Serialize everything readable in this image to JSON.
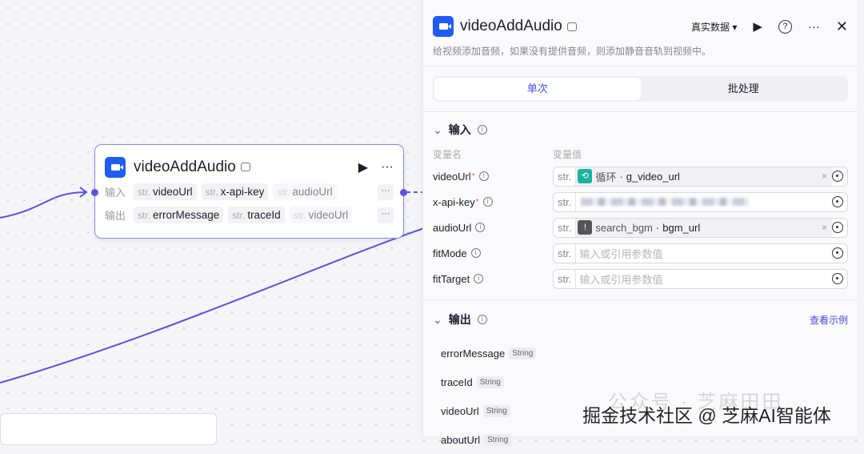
{
  "node": {
    "title": "videoAddAudio",
    "input_label": "输入",
    "output_label": "输出",
    "type_prefix": "str.",
    "inputs": [
      "videoUrl",
      "x-api-key",
      "audioUrl"
    ],
    "outputs": [
      "errorMessage",
      "traceId",
      "videoUrl"
    ],
    "more": "···"
  },
  "panel": {
    "title": "videoAddAudio",
    "data_mode": "真实数据",
    "description": "给视频添加音频，如果没有提供音频，则添加静音音轨到视频中。",
    "tabs": [
      "单次",
      "批处理"
    ],
    "input_section": "输入",
    "col_name": "变量名",
    "col_value": "变量值",
    "type_prefix": "str.",
    "params": [
      {
        "name": "videoUrl",
        "required": true,
        "ref_source": "循环",
        "ref_var": "g_video_url"
      },
      {
        "name": "x-api-key",
        "required": true
      },
      {
        "name": "audioUrl",
        "required": false,
        "ref_source": "search_bgm",
        "ref_var": "bgm_url"
      },
      {
        "name": "fitMode",
        "required": false,
        "placeholder": "输入或引用参数值"
      },
      {
        "name": "fitTarget",
        "required": false,
        "placeholder": "输入或引用参数值"
      }
    ],
    "output_section": "输出",
    "view_example": "查看示例",
    "outputs": [
      {
        "name": "errorMessage",
        "type": "String"
      },
      {
        "name": "traceId",
        "type": "String"
      },
      {
        "name": "videoUrl",
        "type": "String"
      },
      {
        "name": "aboutUrl",
        "type": "String"
      }
    ]
  },
  "watermark": {
    "line1": "公众号 · 芝麻田田",
    "line2": "掘金技术社区 @ 芝麻AI智能体"
  },
  "colors": {
    "accent": "#4c4ad8",
    "edge": "#5a53e0",
    "brand": "#1f5cf5"
  }
}
